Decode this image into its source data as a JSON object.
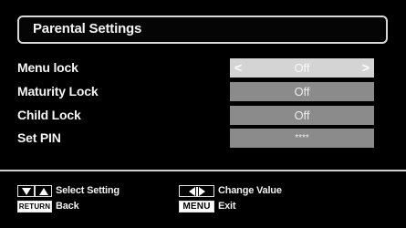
{
  "title": "Parental Settings",
  "rows": [
    {
      "label": "Menu lock",
      "value": "Off",
      "selected": true
    },
    {
      "label": "Maturity Lock",
      "value": "Off",
      "selected": false
    },
    {
      "label": "Child Lock",
      "value": "Off",
      "selected": false
    },
    {
      "label": "Set PIN",
      "value": "****",
      "selected": false
    }
  ],
  "arrows": {
    "left": "<",
    "right": ">"
  },
  "footer": {
    "select_setting": "Select Setting",
    "back": "Back",
    "change_value": "Change Value",
    "exit": "Exit",
    "return_key": "RETURN",
    "menu_key": "MENU"
  },
  "colors": {
    "background": "#000000",
    "row_value": "#8b8b8b",
    "row_value_selected": "#d4d4d4"
  },
  "icons": [
    "down-arrow-key-icon",
    "up-arrow-key-icon",
    "left-arrow-key-icon",
    "right-arrow-key-icon"
  ]
}
